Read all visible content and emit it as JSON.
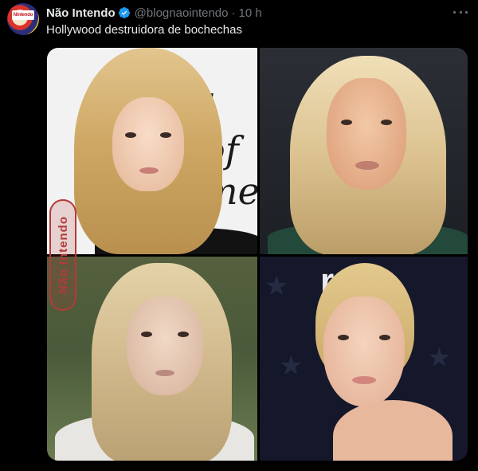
{
  "tweet": {
    "display_name": "Não Intendo",
    "handle": "@blognaointendo",
    "separator": "·",
    "time": "10 h",
    "text": "Hollywood destruidora de bochechas"
  },
  "avatar": {
    "badge_text": "Nintendo"
  },
  "media": {
    "logo_text": "ro",
    "script_text": "l of\nme",
    "watermark": "Não Intendo"
  },
  "icons": {
    "verified": "verified-badge-icon",
    "more": "more-options-icon"
  },
  "colors": {
    "background": "#000000",
    "text_primary": "#e7e9ea",
    "text_secondary": "#71767b",
    "verified_blue": "#1d9bf0"
  }
}
